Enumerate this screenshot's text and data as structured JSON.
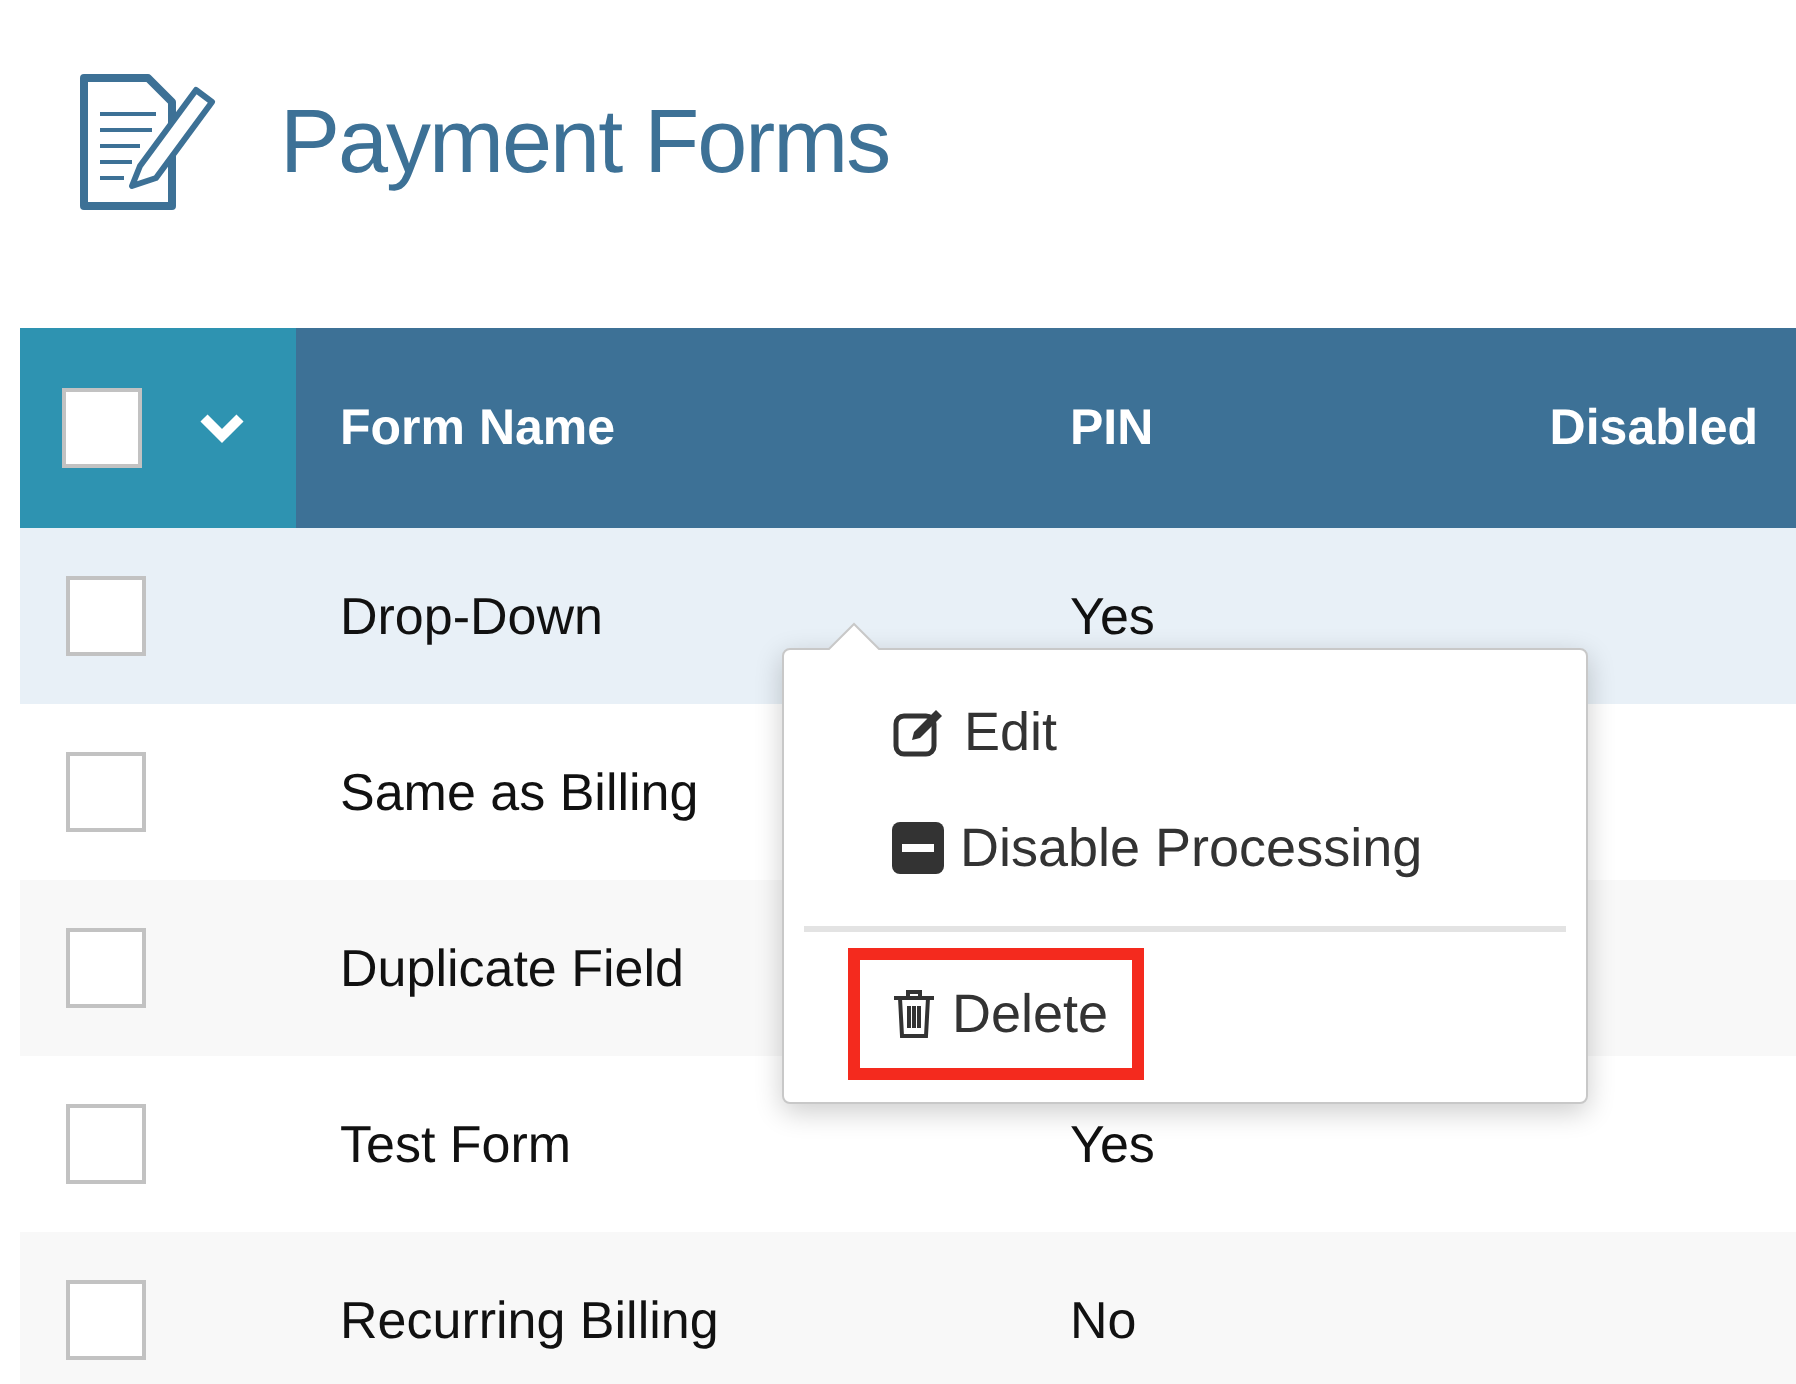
{
  "page": {
    "title": "Payment Forms"
  },
  "table": {
    "select_all": {
      "checked": false
    },
    "columns": [
      "Form Name",
      "PIN",
      "Disabled"
    ],
    "rows": [
      {
        "name": "Drop-Down",
        "pin": "Yes",
        "checked": false,
        "active": true
      },
      {
        "name": "Same as Billing",
        "checked": false,
        "active": false
      },
      {
        "name": "Duplicate Field",
        "checked": false,
        "active": false
      },
      {
        "name": "Test Form",
        "pin": "Yes",
        "checked": false,
        "active": false
      },
      {
        "name": "Recurring Billing",
        "pin": "No",
        "checked": false,
        "active": false
      }
    ]
  },
  "context_menu": {
    "items": [
      {
        "kind": "edit",
        "label": "Edit",
        "highlighted": false
      },
      {
        "kind": "disable",
        "label": "Disable Processing",
        "highlighted": false
      },
      {
        "kind": "divider"
      },
      {
        "kind": "delete",
        "label": "Delete",
        "highlighted": true
      }
    ]
  }
}
